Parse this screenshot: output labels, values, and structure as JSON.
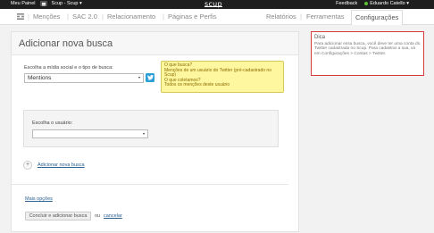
{
  "topbar": {
    "panel": "Meu Painel",
    "account": "Scup - Scup ▾",
    "logo": "scup",
    "feedback": "Feedback",
    "user": "Eduardo Catello ▾"
  },
  "nav": {
    "items": [
      "Menções",
      "SAC 2.0",
      "Relacionamento",
      "Páginas e Perfis",
      "Relatórios",
      "Ferramentas"
    ],
    "active": "Configurações"
  },
  "form": {
    "title": "Adicionar nova busca",
    "type_label": "Escolha a mídia social e o tipo de busca:",
    "type_value": "Mentions",
    "tip": {
      "q1": "O que busca?",
      "a1": "Menções de um usuário do Twitter (pré-cadastrado no Scup)",
      "q2": "O que coletamos?",
      "a2": "Todos os menções deste usuário"
    },
    "user_label": "Escolha o usuário:",
    "user_value": "",
    "add_label": "Adicionar nova busca",
    "more_options": "Mais opções",
    "submit": "Concluir e adicionar busca",
    "or": "ou",
    "cancel": "cancelar"
  },
  "hint": {
    "title": "Dica",
    "text": "Para adicionar essa busca, você deve ter uma conta do Twitter cadastrada no Scup. Para cadastrar a sua, vá em Configurações > Contas > Twitter."
  }
}
